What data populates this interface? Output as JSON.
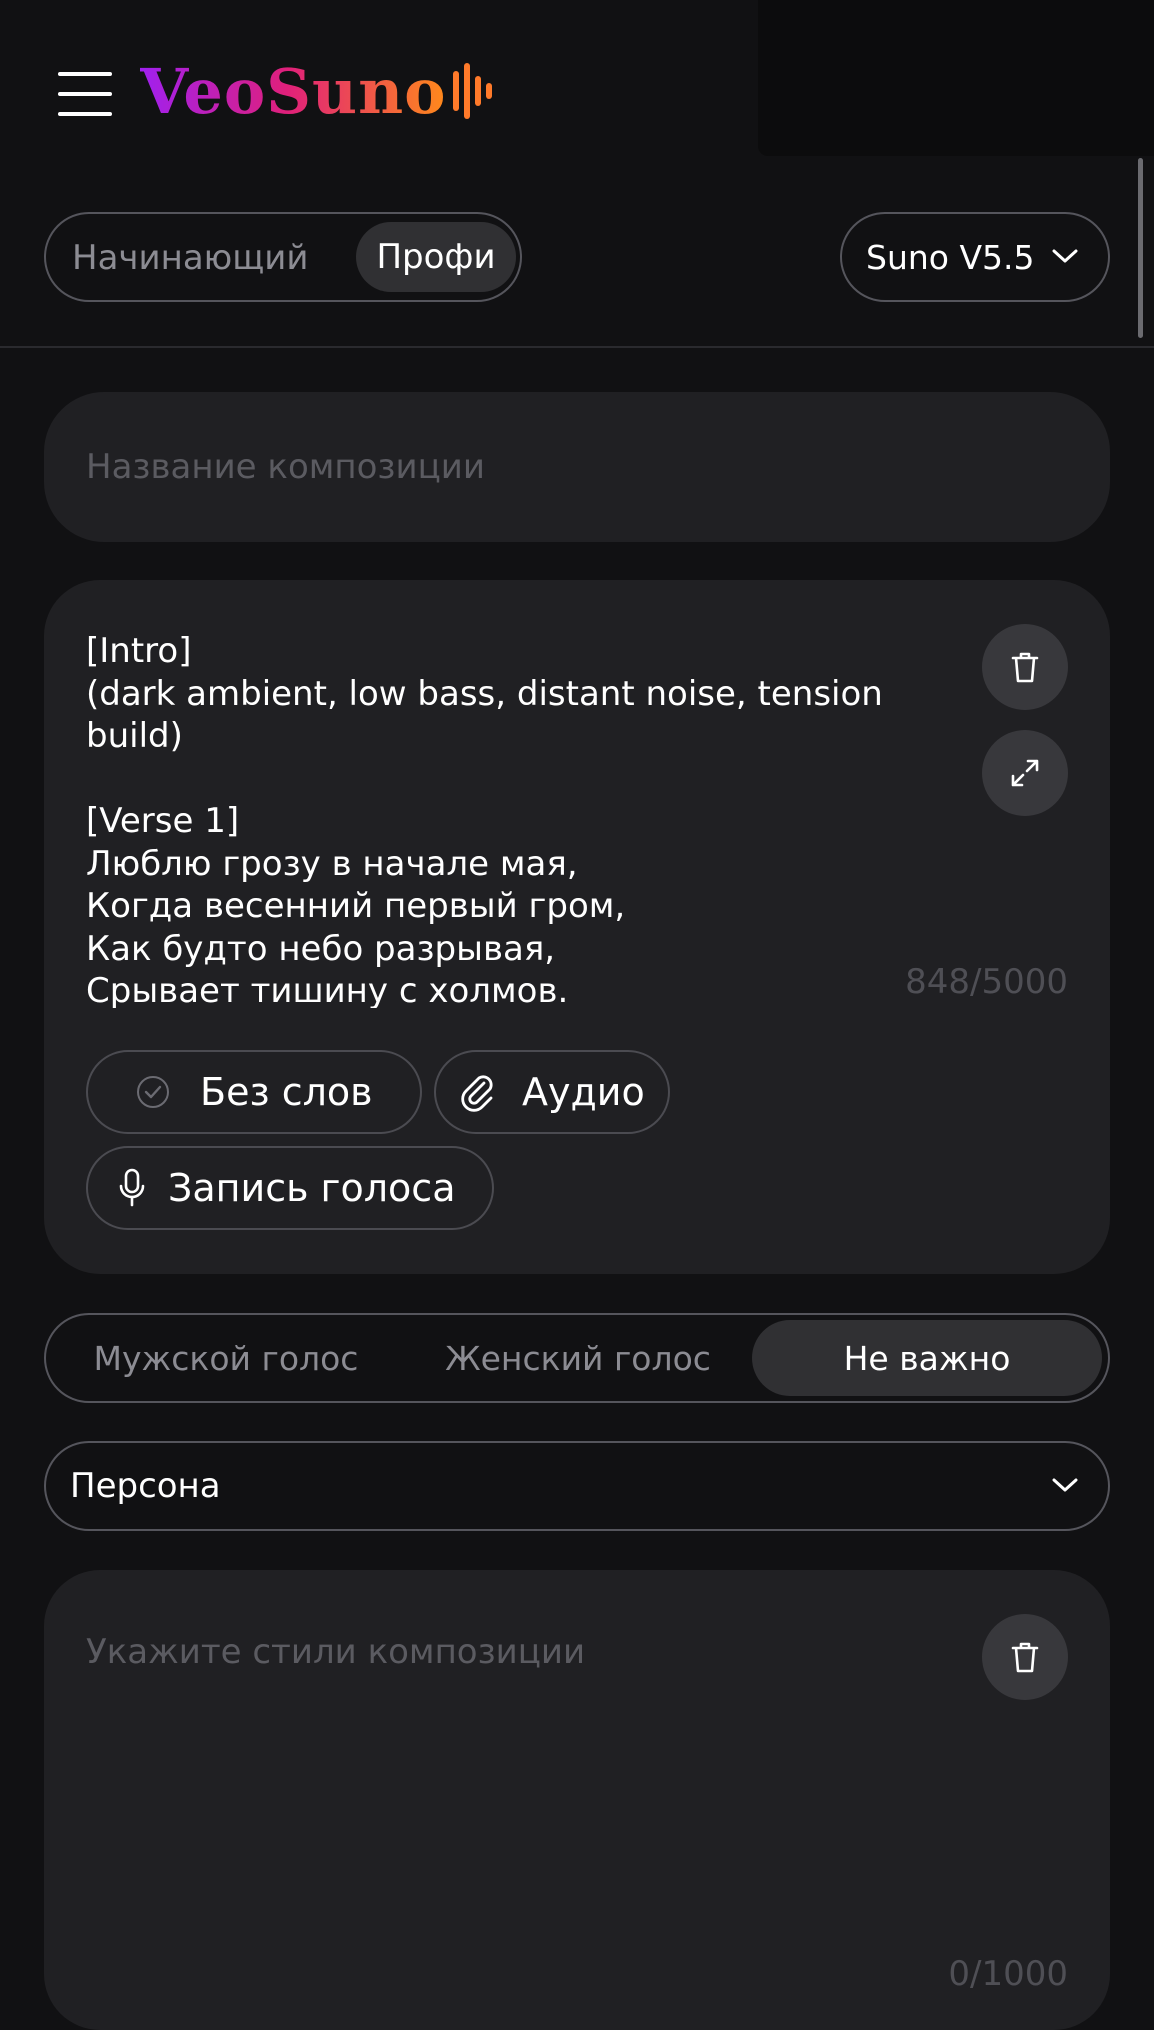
{
  "header": {
    "logo_text": "VeoSuno",
    "logo_gradient": [
      "#a020f0",
      "#e0207a",
      "#ff8a1a"
    ]
  },
  "mode": {
    "options": [
      "Начинающий",
      "Профи"
    ],
    "selected": "Профи"
  },
  "model": {
    "value": "Suno V5.5"
  },
  "title_field": {
    "placeholder": "Название композиции",
    "value": ""
  },
  "lyrics": {
    "text": "[Intro]\n(dark ambient, low bass, distant noise, tension build)\n\n[Verse 1]\nЛюблю грозу в начале мая,\nКогда весенний первый гром,\nКак будто небо разрывая,\nСрывает тишину с холмов.",
    "counter": "848/5000",
    "chips": {
      "instrumental": "Без слов",
      "audio": "Аудио",
      "voice_record": "Запись голоса"
    }
  },
  "voice": {
    "options": [
      "Мужской голос",
      "Женский голос",
      "Не важно"
    ],
    "selected": "Не важно"
  },
  "persona": {
    "label": "Персона"
  },
  "styles": {
    "placeholder": "Укажите стили композиции",
    "value": "",
    "counter": "0/1000"
  },
  "icons": [
    "menu-icon",
    "chevron-down-icon",
    "trash-icon",
    "expand-icon",
    "check-circle-icon",
    "paperclip-icon",
    "microphone-icon",
    "audio-bars-icon"
  ]
}
